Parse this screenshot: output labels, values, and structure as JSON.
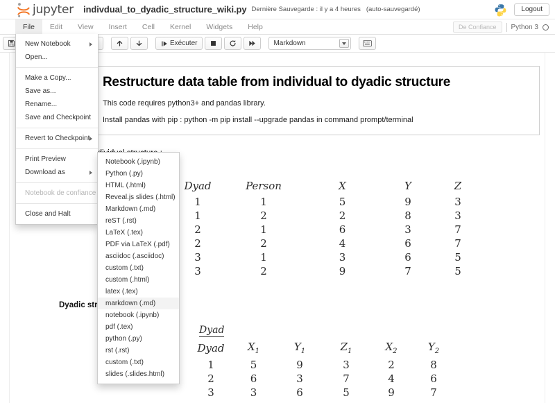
{
  "header": {
    "brand": "jupyter",
    "notebook_name": "indivdual_to_dyadic_structure_wiki.py",
    "save_status": "Dernière Sauvegarde : il y a 4 heures",
    "autosave": "(auto-sauvegardé)",
    "logout_label": "Logout"
  },
  "menubar": {
    "items": [
      {
        "label": "File",
        "active": true
      },
      {
        "label": "Edit",
        "active": false
      },
      {
        "label": "View",
        "active": false
      },
      {
        "label": "Insert",
        "active": false
      },
      {
        "label": "Cell",
        "active": false
      },
      {
        "label": "Kernel",
        "active": false
      },
      {
        "label": "Widgets",
        "active": false
      },
      {
        "label": "Help",
        "active": false
      }
    ],
    "trusted_label": "De Confiance",
    "kernel_label": "Python 3"
  },
  "toolbar": {
    "save_icon": "save-icon",
    "add_icon": "add-cell-icon",
    "cut_icon": "cut-icon",
    "copy_icon": "copy-icon",
    "paste_icon": "paste-icon",
    "up_icon": "move-up-icon",
    "down_icon": "move-down-icon",
    "run_label": "Exécuter",
    "stop_icon": "stop-icon",
    "restart_icon": "restart-icon",
    "restart_run_icon": "restart-run-all-icon",
    "cell_type": "Markdown",
    "keyboard_icon": "command-palette-icon"
  },
  "file_menu": {
    "groups": [
      [
        {
          "label": "New Notebook",
          "submenu": true,
          "disabled": false
        },
        {
          "label": "Open...",
          "submenu": false,
          "disabled": false
        }
      ],
      [
        {
          "label": "Make a Copy...",
          "submenu": false,
          "disabled": false
        },
        {
          "label": "Save as...",
          "submenu": false,
          "disabled": false
        },
        {
          "label": "Rename...",
          "submenu": false,
          "disabled": false
        },
        {
          "label": "Save and Checkpoint",
          "submenu": false,
          "disabled": false
        }
      ],
      [
        {
          "label": "Revert to Checkpoint",
          "submenu": true,
          "disabled": false
        }
      ],
      [
        {
          "label": "Print Preview",
          "submenu": false,
          "disabled": false
        },
        {
          "label": "Download as",
          "submenu": true,
          "disabled": false
        }
      ],
      [
        {
          "label": "Notebook de confiance",
          "submenu": false,
          "disabled": true
        }
      ],
      [
        {
          "label": "Close and Halt",
          "submenu": false,
          "disabled": false
        }
      ]
    ]
  },
  "download_submenu": {
    "items": [
      {
        "label": "Notebook (.ipynb)",
        "hover": false
      },
      {
        "label": "Python (.py)",
        "hover": false
      },
      {
        "label": "HTML (.html)",
        "hover": false
      },
      {
        "label": "Reveal.js slides (.html)",
        "hover": false
      },
      {
        "label": "Markdown (.md)",
        "hover": false
      },
      {
        "label": "reST (.rst)",
        "hover": false
      },
      {
        "label": "LaTeX (.tex)",
        "hover": false
      },
      {
        "label": "PDF via LaTeX (.pdf)",
        "hover": false
      },
      {
        "label": "asciidoc (.asciidoc)",
        "hover": false
      },
      {
        "label": "custom (.txt)",
        "hover": false
      },
      {
        "label": "custom (.html)",
        "hover": false
      },
      {
        "label": "latex (.tex)",
        "hover": false
      },
      {
        "label": "markdown (.md)",
        "hover": true
      },
      {
        "label": "notebook (.ipynb)",
        "hover": false
      },
      {
        "label": "pdf (.tex)",
        "hover": false
      },
      {
        "label": "python (.py)",
        "hover": false
      },
      {
        "label": "rst (.rst)",
        "hover": false
      },
      {
        "label": "custom (.txt)",
        "hover": false
      },
      {
        "label": "slides (.slides.html)",
        "hover": false
      }
    ]
  },
  "notebook": {
    "markdown_cell": {
      "heading": "Restructure data table from individual to dyadic structure",
      "paragraph_1": "This code requires python3+ and pandas library.",
      "paragraph_2": "Install pandas with pip : python -m pip install --upgrade pandas in command prompt/terminal"
    },
    "individual_label": "Individual structure :",
    "dyadic_label": "Dyadic structure :",
    "individual_table": {
      "caption": "",
      "columns": [
        "Dyad",
        "Person",
        "X",
        "Y",
        "Z"
      ],
      "rows": [
        [
          "1",
          "1",
          "5",
          "9",
          "3"
        ],
        [
          "1",
          "2",
          "2",
          "8",
          "3"
        ],
        [
          "2",
          "1",
          "6",
          "3",
          "7"
        ],
        [
          "2",
          "2",
          "4",
          "6",
          "7"
        ],
        [
          "3",
          "1",
          "3",
          "6",
          "5"
        ],
        [
          "3",
          "2",
          "9",
          "7",
          "5"
        ]
      ]
    },
    "dyadic_table": {
      "caption": "Dyad",
      "columns": [
        {
          "base": "Dyad",
          "sub": ""
        },
        {
          "base": "X",
          "sub": "1"
        },
        {
          "base": "Y",
          "sub": "1"
        },
        {
          "base": "Z",
          "sub": "1"
        },
        {
          "base": "X",
          "sub": "2"
        },
        {
          "base": "Y",
          "sub": "2"
        }
      ],
      "rows": [
        [
          "1",
          "5",
          "9",
          "3",
          "2",
          "8"
        ],
        [
          "2",
          "6",
          "3",
          "7",
          "4",
          "6"
        ],
        [
          "3",
          "3",
          "6",
          "5",
          "9",
          "7"
        ]
      ]
    }
  }
}
